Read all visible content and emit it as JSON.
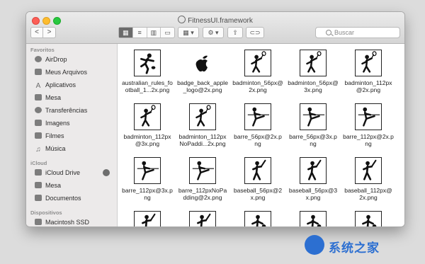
{
  "window": {
    "title": "FitnessUI.framework"
  },
  "toolbar": {
    "back_label": "<",
    "forward_label": ">",
    "view_modes": [
      "▦",
      "≡",
      "▥",
      "▭"
    ],
    "arrange_label": "▦ ▾",
    "action_label": "⚙ ▾",
    "share_label": "⇧",
    "tag_label": "⊂⊃",
    "search_placeholder": "Buscar"
  },
  "sidebar": {
    "favorites_header": "Favoritos",
    "favorites": [
      {
        "label": "AirDrop",
        "icon": "airdrop-icon"
      },
      {
        "label": "Meus Arquivos",
        "icon": "all-files-icon"
      },
      {
        "label": "Aplicativos",
        "icon": "applications-icon"
      },
      {
        "label": "Mesa",
        "icon": "desktop-icon"
      },
      {
        "label": "Transferências",
        "icon": "downloads-icon"
      },
      {
        "label": "Imagens",
        "icon": "pictures-icon"
      },
      {
        "label": "Filmes",
        "icon": "movies-icon"
      },
      {
        "label": "Música",
        "icon": "music-icon"
      }
    ],
    "icloud_header": "iCloud",
    "icloud": [
      {
        "label": "iCloud Drive",
        "icon": "cloud-icon"
      },
      {
        "label": "Mesa",
        "icon": "desktop-icon"
      },
      {
        "label": "Documentos",
        "icon": "documents-icon"
      }
    ],
    "devices_header": "Dispositivos",
    "devices": [
      {
        "label": "Macintosh SSD",
        "icon": "disk-icon"
      }
    ]
  },
  "files": [
    {
      "name": "australian_rules_football_1...2x.png",
      "icon": "football-kick-icon"
    },
    {
      "name": "badge_back_apple_logo@2x.png",
      "icon": "apple-logo-icon"
    },
    {
      "name": "badminton_56px@2x.png",
      "icon": "badminton-icon"
    },
    {
      "name": "badminton_56px@3x.png",
      "icon": "badminton-icon"
    },
    {
      "name": "badminton_112px@2x.png",
      "icon": "badminton-icon"
    },
    {
      "name": "badminton_112px@3x.png",
      "icon": "badminton-icon"
    },
    {
      "name": "badminton_112px NoPaddi...2x.png",
      "icon": "badminton-icon"
    },
    {
      "name": "barre_56px@2x.png",
      "icon": "barre-icon"
    },
    {
      "name": "barre_56px@3x.png",
      "icon": "barre-icon"
    },
    {
      "name": "barre_112px@2x.png",
      "icon": "barre-icon"
    },
    {
      "name": "barre_112px@3x.png",
      "icon": "barre-icon"
    },
    {
      "name": "barre_112pxNoPadding@2x.png",
      "icon": "barre-icon"
    },
    {
      "name": "baseball_56px@2x.png",
      "icon": "baseball-icon"
    },
    {
      "name": "baseball_56px@3x.png",
      "icon": "baseball-icon"
    },
    {
      "name": "baseball_112px@2x.png",
      "icon": "baseball-icon"
    },
    {
      "name": "",
      "icon": "baseball-icon"
    },
    {
      "name": "",
      "icon": "baseball-icon"
    },
    {
      "name": "",
      "icon": "basketball-icon"
    },
    {
      "name": "",
      "icon": "basketball-icon"
    },
    {
      "name": "",
      "icon": "basketball-icon"
    }
  ],
  "watermark": {
    "text": "系统之家"
  }
}
